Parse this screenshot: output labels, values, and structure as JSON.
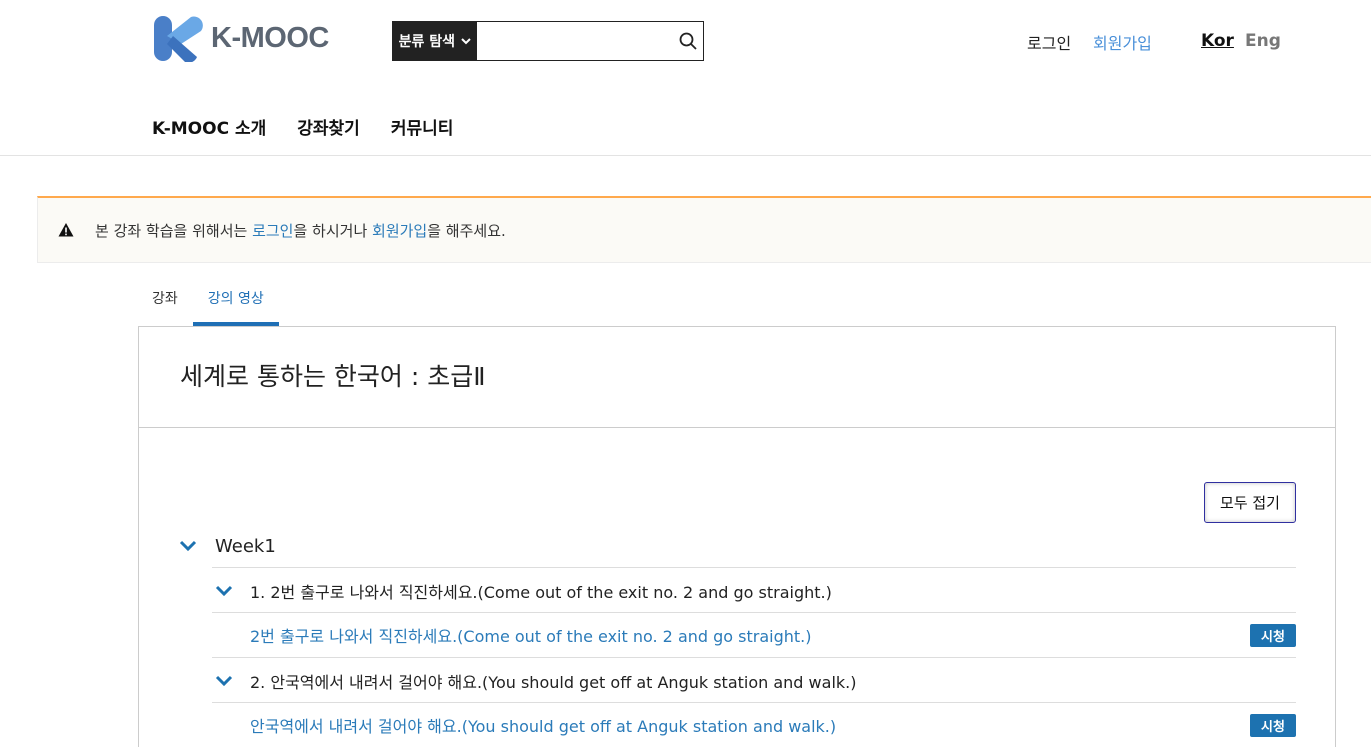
{
  "header": {
    "logo_text": "K-MOOC",
    "search": {
      "category_label": "분류 탐색",
      "value": "",
      "placeholder": ""
    },
    "login": "로그인",
    "signup": "회원가입",
    "lang_kor": "Kor",
    "lang_eng": "Eng",
    "nav": [
      "K-MOOC 소개",
      "강좌찾기",
      "커뮤니티"
    ]
  },
  "notice": {
    "prefix": "본 강좌 학습을 위해서는 ",
    "login_link": "로그인",
    "middle": "을 하시거나 ",
    "signup_link": "회원가입",
    "suffix": "을 해주세요."
  },
  "tabs": [
    "강좌",
    "강의 영상"
  ],
  "course": {
    "title": "세계로 통하는 한국어 : 초급Ⅱ",
    "collapse_all": "모두 접기",
    "week": "Week1",
    "units": [
      {
        "label": "1. 2번 출구로 나와서 직진하세요.(Come out of the exit no. 2 and go straight.)",
        "lesson": "2번 출구로 나와서 직진하세요.(Come out of the exit no. 2 and go straight.)",
        "watch": "시청"
      },
      {
        "label": "2. 안국역에서 내려서 걸어야 해요.(You should get off at Anguk station and walk.)",
        "lesson": "안국역에서 내려서 걸어야 해요.(You should get off at Anguk station and walk.)",
        "watch": "시청"
      }
    ]
  },
  "colors": {
    "accent": "#1d72b0",
    "link": "#2b7bb9",
    "warning": "#ffa94d"
  }
}
